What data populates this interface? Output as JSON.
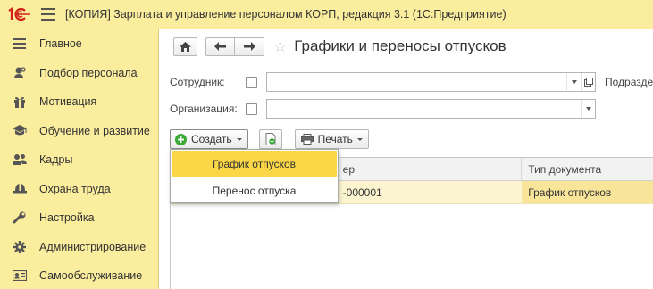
{
  "titlebar": {
    "app_title": "[КОПИЯ] Зарплата и управление персоналом КОРП, редакция 3.1  (1С:Предприятие)"
  },
  "sidebar": {
    "items": [
      {
        "label": "Главное",
        "icon": "menu-lines-icon"
      },
      {
        "label": "Подбор персонала",
        "icon": "person-search-icon"
      },
      {
        "label": "Мотивация",
        "icon": "gift-icon"
      },
      {
        "label": "Обучение и развитие",
        "icon": "graduation-cap-icon"
      },
      {
        "label": "Кадры",
        "icon": "people-icon"
      },
      {
        "label": "Охрана труда",
        "icon": "helmet-icon"
      },
      {
        "label": "Настройка",
        "icon": "wrench-icon"
      },
      {
        "label": "Администрирование",
        "icon": "gear-icon"
      },
      {
        "label": "Самообслуживание",
        "icon": "id-card-icon"
      }
    ]
  },
  "main": {
    "page_title": "Графики и переносы отпусков",
    "filters": {
      "employee_label": "Сотрудник:",
      "employee_value": "",
      "department_label": "Подразде",
      "organization_label": "Организация:",
      "organization_value": ""
    },
    "toolbar": {
      "create_label": "Создать",
      "print_label": "Печать"
    },
    "create_menu": {
      "items": [
        "График отпусков",
        "Перенос отпуска"
      ],
      "active_index": 0
    },
    "table": {
      "columns": [
        "",
        "ер",
        "Тип документа"
      ],
      "rows": [
        {
          "date": "",
          "number": "-000001",
          "doc_type": "График отпусков"
        }
      ]
    }
  },
  "colors": {
    "panel_yellow": "#fbed9e",
    "menu_highlight": "#fbd647",
    "row_highlight": "#fbf4cf",
    "create_icon_green": "#3aa935"
  }
}
